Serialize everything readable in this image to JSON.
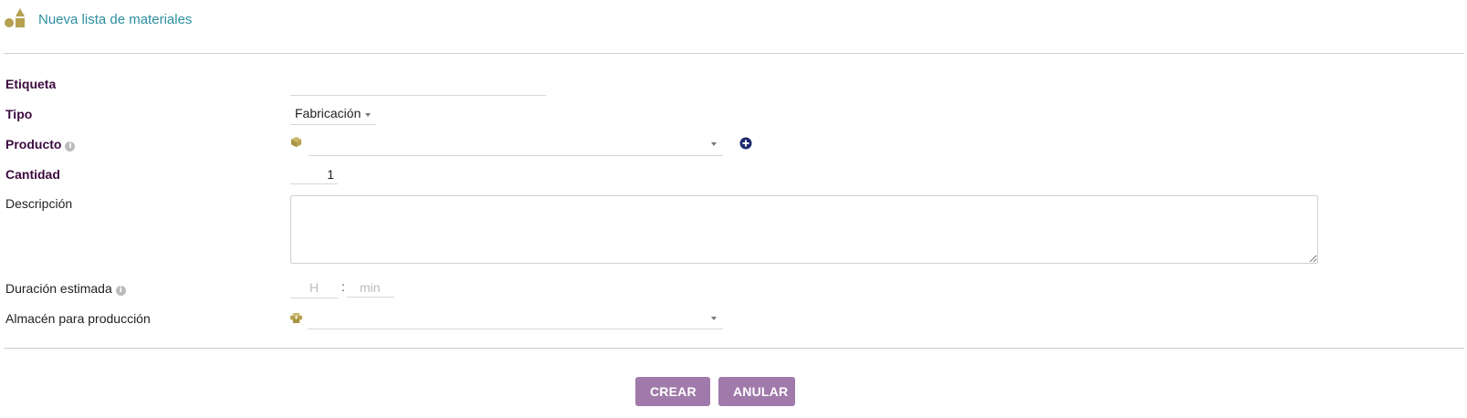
{
  "header": {
    "title": "Nueva lista de materiales",
    "icon": "shapes-icon"
  },
  "form": {
    "etiqueta": {
      "label": "Etiqueta",
      "value": ""
    },
    "tipo": {
      "label": "Tipo",
      "value": "Fabricación"
    },
    "producto": {
      "label": "Producto",
      "value": "",
      "icon": "box-icon",
      "add_icon": "plus-circle-icon"
    },
    "cantidad": {
      "label": "Cantidad",
      "value": "1"
    },
    "descripcion": {
      "label": "Descripción",
      "value": ""
    },
    "duracion": {
      "label": "Duración estimada",
      "hours_placeholder": "H",
      "separator": ":",
      "minutes_placeholder": "min"
    },
    "almacen": {
      "label": "Almacén para producción",
      "value": "",
      "icon": "boxes-icon"
    }
  },
  "actions": {
    "create_label": "CREAR",
    "cancel_label": "ANULAR"
  },
  "colors": {
    "accent": "#a07aaa",
    "title": "#2c8ea0",
    "required_label": "#3c0b3e",
    "icon_gold": "#b5a150",
    "add_icon": "#1e2a6e"
  }
}
